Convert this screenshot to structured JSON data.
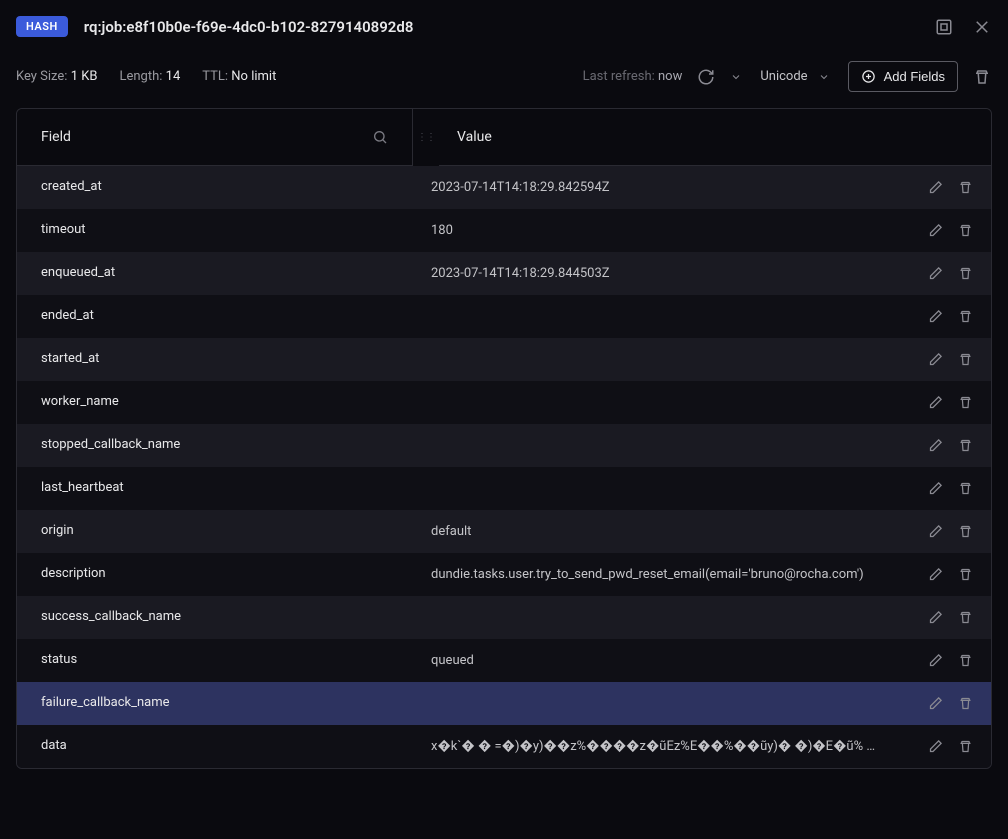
{
  "header": {
    "badge": "HASH",
    "key": "rq:job:e8f10b0e-f69e-4dc0-b102-8279140892d8"
  },
  "meta": {
    "keySizeLabel": "Key Size:",
    "keySizeVal": "1 KB",
    "lengthLabel": "Length:",
    "lengthVal": "14",
    "ttlLabel": "TTL:",
    "ttlVal": "No limit",
    "lastRefreshLabel": "Last refresh:",
    "lastRefreshVal": "now",
    "encoding": "Unicode",
    "addFieldsLabel": "Add Fields"
  },
  "columns": {
    "field": "Field",
    "value": "Value"
  },
  "rows": [
    {
      "field": "created_at",
      "value": "2023-07-14T14:18:29.842594Z",
      "selected": false
    },
    {
      "field": "timeout",
      "value": "180",
      "selected": false
    },
    {
      "field": "enqueued_at",
      "value": "2023-07-14T14:18:29.844503Z",
      "selected": false
    },
    {
      "field": "ended_at",
      "value": "",
      "selected": false
    },
    {
      "field": "started_at",
      "value": "",
      "selected": false
    },
    {
      "field": "worker_name",
      "value": "",
      "selected": false
    },
    {
      "field": "stopped_callback_name",
      "value": "",
      "selected": false
    },
    {
      "field": "last_heartbeat",
      "value": "",
      "selected": false
    },
    {
      "field": "origin",
      "value": "default",
      "selected": false
    },
    {
      "field": "description",
      "value": "dundie.tasks.user.try_to_send_pwd_reset_email(email='bruno@rocha.com')",
      "selected": false
    },
    {
      "field": "success_callback_name",
      "value": "",
      "selected": false
    },
    {
      "field": "status",
      "value": "queued",
      "selected": false
    },
    {
      "field": "failure_callback_name",
      "value": "",
      "selected": true
    },
    {
      "field": "data",
      "value": "x�k`� �   =�)�y)��z%����z�ũEz%E��%��ũy)� �)�E�ũ%  …",
      "selected": false
    }
  ]
}
